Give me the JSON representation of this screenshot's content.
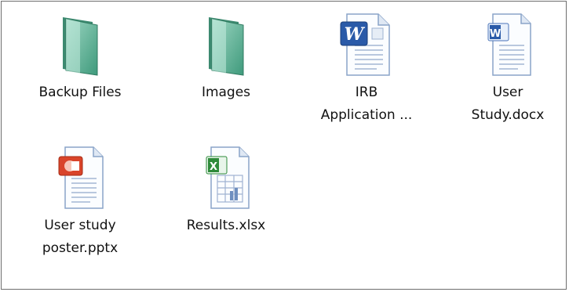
{
  "explorer": {
    "items": [
      {
        "label": "Backup Files",
        "type": "folder",
        "icon": "folder-icon"
      },
      {
        "label": "Images",
        "type": "folder",
        "icon": "folder-icon"
      },
      {
        "label": "IRB Application ...",
        "type": "docx",
        "icon": "word-document-icon"
      },
      {
        "label": "User Study.docx",
        "type": "docx",
        "icon": "word-document-icon"
      },
      {
        "label": "User study poster.pptx",
        "type": "pptx",
        "icon": "powerpoint-document-icon"
      },
      {
        "label": "Results.xlsx",
        "type": "xlsx",
        "icon": "excel-document-icon"
      }
    ]
  },
  "colors": {
    "folder": "#5fb89a",
    "word": "#2a5aa8",
    "powerpoint": "#d9442a",
    "excel": "#2e8a3a",
    "border": "#6e6e6e"
  }
}
